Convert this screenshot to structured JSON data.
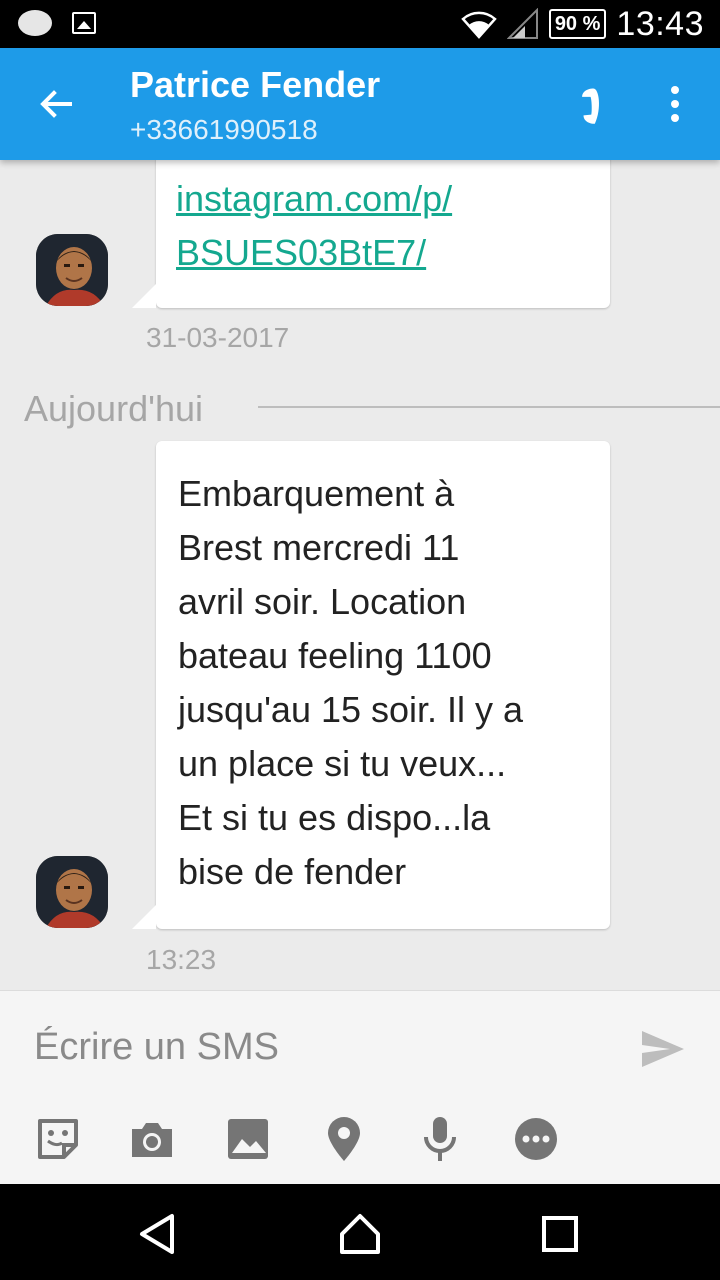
{
  "status_bar": {
    "battery": "90 %",
    "time": "13:43",
    "icons": [
      "notification-oval-icon",
      "image-notification-icon",
      "wifi-icon",
      "signal-icon",
      "battery-icon"
    ]
  },
  "app_bar": {
    "contact_name": "Patrice Fender",
    "contact_number": "+33661990518",
    "icons": [
      "back-arrow-icon",
      "phone-icon",
      "more-vert-icon"
    ],
    "accent_color": "#1e9be8"
  },
  "messages": {
    "first": {
      "link_lines": [
        "instagram.com/p/",
        "BSUES03BtE7/"
      ],
      "timestamp": "31-03-2017"
    },
    "day_separator": "Aujourd'hui",
    "second": {
      "lines": [
        "Embarquement à",
        "Brest mercredi 11",
        "avril soir. Location",
        "bateau feeling 1100",
        "jusqu'au 15 soir. Il y a",
        "un place si tu veux...",
        "Et si tu es dispo...la",
        "bise de fender"
      ],
      "timestamp": "13:23"
    },
    "link_color": "#14a88f"
  },
  "compose": {
    "placeholder": "Écrire un SMS",
    "attachments": [
      "sticker-icon",
      "camera-icon",
      "gallery-icon",
      "location-icon",
      "microphone-icon",
      "more-icon"
    ]
  },
  "nav_bar": {
    "buttons": [
      "back-triangle-icon",
      "home-icon",
      "recents-icon"
    ]
  }
}
